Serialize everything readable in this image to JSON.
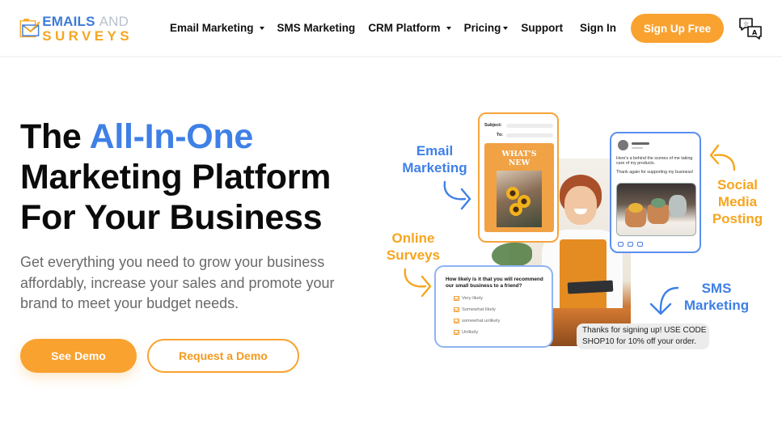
{
  "brand": {
    "logo_line1_a": "EMAILS",
    "logo_line1_b": "AND",
    "logo_line2": "SURVEYS",
    "colors": {
      "orange": "#f9a230",
      "blue": "#3f80e6",
      "text": "#111111",
      "muted": "#6a6a6a"
    }
  },
  "nav": {
    "items": [
      {
        "label": "Email Marketing",
        "dropdown": true
      },
      {
        "label": "SMS Marketing",
        "dropdown": false
      },
      {
        "label": "CRM Platform",
        "dropdown": true
      },
      {
        "label": "Pricing",
        "dropdown": true
      },
      {
        "label": "Support",
        "dropdown": false
      }
    ],
    "sign_in": "Sign In",
    "sign_up": "Sign Up Free",
    "language_icon": "translate-icon"
  },
  "hero": {
    "title_prefix": "The ",
    "title_accent": "All-In-One",
    "title_line2": "Marketing Platform",
    "title_line3": "For Your Business",
    "subtitle": "Get everything you need to grow your business affordably, increase your sales and promote your brand to meet your budget needs.",
    "primary_button": "See Demo",
    "secondary_button": "Request a Demo"
  },
  "illustration": {
    "labels": {
      "email": [
        "Email",
        "Marketing"
      ],
      "social": [
        "Social",
        "Media",
        "Posting"
      ],
      "surveys": [
        "Online",
        "Surveys"
      ],
      "sms": [
        "SMS",
        "Marketing"
      ]
    },
    "email_card": {
      "subject_label": "Subject:",
      "to_label": "To:",
      "poster_title_1": "WHAT'S",
      "poster_title_2": "NEW"
    },
    "social_card": {
      "post_text_1": "Here's a behind the scenes of me taking care of my products.",
      "post_text_2": "Thank again for supporting my business!"
    },
    "survey_card": {
      "question": "How likely is it that you will recommend our small business to a friend?",
      "options": [
        "Very likely",
        "Somewhat likely",
        "somewhat unlikely",
        "Unlikely"
      ]
    },
    "sms_message": "Thanks for signing up! USE CODE SHOP10 for 10% off your order."
  }
}
